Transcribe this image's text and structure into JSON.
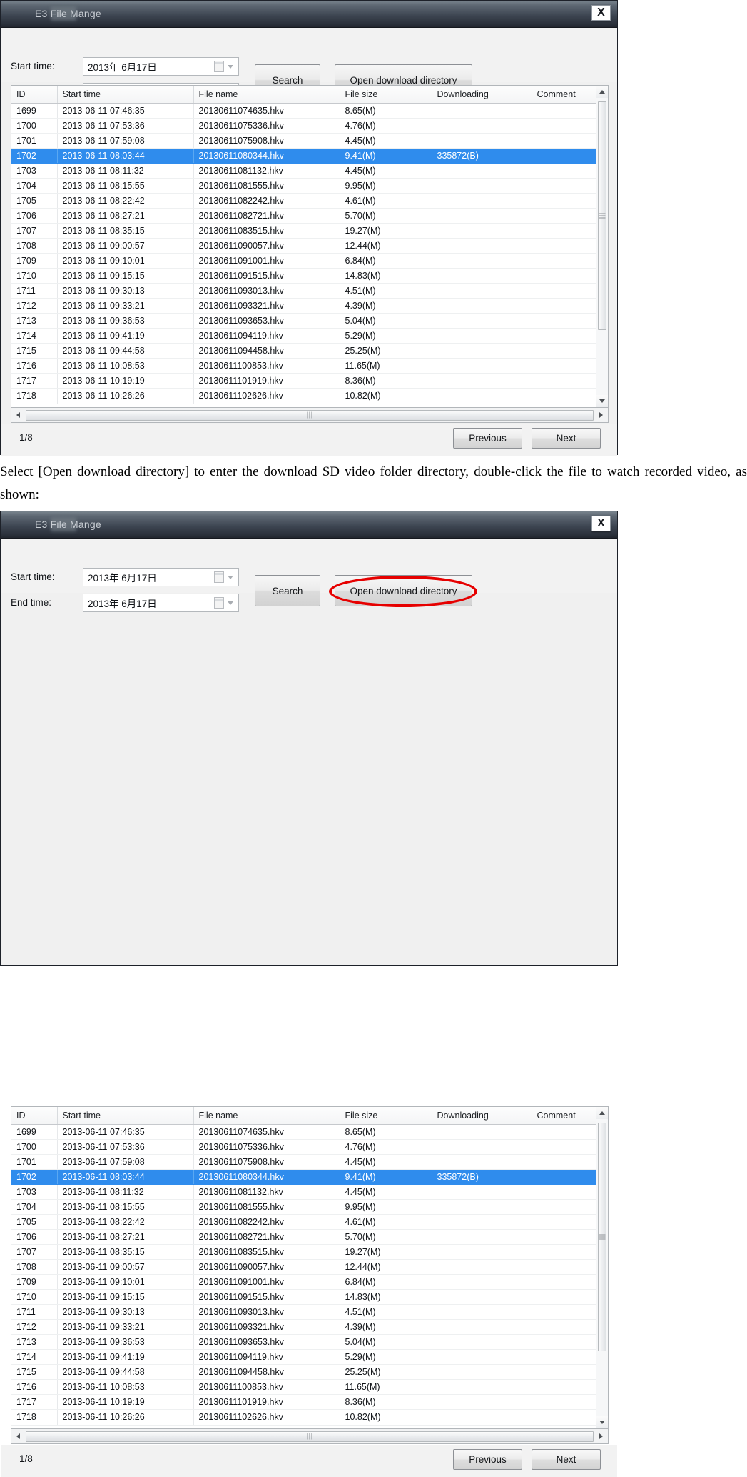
{
  "window": {
    "title": "E3       File Mange",
    "title_prefix": "E3",
    "close_label": "X"
  },
  "toolbar": {
    "start_time_label": "Start time:",
    "end_time_label": "End time:",
    "start_time_value": "2013年 6月17日",
    "end_time_value": "2013年 6月17日",
    "date_placeholder": "2013年 6月17日",
    "search_label": "Search",
    "open_download_label": "Open download directory"
  },
  "table": {
    "columns": [
      "ID",
      "Start time",
      "File name",
      "File size",
      "Downloading",
      "Comment"
    ],
    "rows": [
      {
        "id": "1699",
        "start": "2013-06-11 07:46:35",
        "file": "20130611074635.hkv",
        "size": "8.65(M)",
        "down": "",
        "comment": ""
      },
      {
        "id": "1700",
        "start": "2013-06-11 07:53:36",
        "file": "20130611075336.hkv",
        "size": "4.76(M)",
        "down": "",
        "comment": ""
      },
      {
        "id": "1701",
        "start": "2013-06-11 07:59:08",
        "file": "20130611075908.hkv",
        "size": "4.45(M)",
        "down": "",
        "comment": ""
      },
      {
        "id": "1702",
        "start": "2013-06-11 08:03:44",
        "file": "20130611080344.hkv",
        "size": "9.41(M)",
        "down": "335872(B)",
        "comment": "",
        "selected": true
      },
      {
        "id": "1703",
        "start": "2013-06-11 08:11:32",
        "file": "20130611081132.hkv",
        "size": "4.45(M)",
        "down": "",
        "comment": ""
      },
      {
        "id": "1704",
        "start": "2013-06-11 08:15:55",
        "file": "20130611081555.hkv",
        "size": "9.95(M)",
        "down": "",
        "comment": ""
      },
      {
        "id": "1705",
        "start": "2013-06-11 08:22:42",
        "file": "20130611082242.hkv",
        "size": "4.61(M)",
        "down": "",
        "comment": ""
      },
      {
        "id": "1706",
        "start": "2013-06-11 08:27:21",
        "file": "20130611082721.hkv",
        "size": "5.70(M)",
        "down": "",
        "comment": ""
      },
      {
        "id": "1707",
        "start": "2013-06-11 08:35:15",
        "file": "20130611083515.hkv",
        "size": "19.27(M)",
        "down": "",
        "comment": ""
      },
      {
        "id": "1708",
        "start": "2013-06-11 09:00:57",
        "file": "20130611090057.hkv",
        "size": "12.44(M)",
        "down": "",
        "comment": ""
      },
      {
        "id": "1709",
        "start": "2013-06-11 09:10:01",
        "file": "20130611091001.hkv",
        "size": "6.84(M)",
        "down": "",
        "comment": ""
      },
      {
        "id": "1710",
        "start": "2013-06-11 09:15:15",
        "file": "20130611091515.hkv",
        "size": "14.83(M)",
        "down": "",
        "comment": ""
      },
      {
        "id": "1711",
        "start": "2013-06-11 09:30:13",
        "file": "20130611093013.hkv",
        "size": "4.51(M)",
        "down": "",
        "comment": ""
      },
      {
        "id": "1712",
        "start": "2013-06-11 09:33:21",
        "file": "20130611093321.hkv",
        "size": "4.39(M)",
        "down": "",
        "comment": ""
      },
      {
        "id": "1713",
        "start": "2013-06-11 09:36:53",
        "file": "20130611093653.hkv",
        "size": "5.04(M)",
        "down": "",
        "comment": ""
      },
      {
        "id": "1714",
        "start": "2013-06-11 09:41:19",
        "file": "20130611094119.hkv",
        "size": "5.29(M)",
        "down": "",
        "comment": ""
      },
      {
        "id": "1715",
        "start": "2013-06-11 09:44:58",
        "file": "20130611094458.hkv",
        "size": "25.25(M)",
        "down": "",
        "comment": ""
      },
      {
        "id": "1716",
        "start": "2013-06-11 10:08:53",
        "file": "20130611100853.hkv",
        "size": "11.65(M)",
        "down": "",
        "comment": ""
      },
      {
        "id": "1717",
        "start": "2013-06-11 10:19:19",
        "file": "20130611101919.hkv",
        "size": "8.36(M)",
        "down": "",
        "comment": ""
      },
      {
        "id": "1718",
        "start": "2013-06-11 10:26:26",
        "file": "20130611102626.hkv",
        "size": "10.82(M)",
        "down": "",
        "comment": "",
        "clipped": true
      }
    ]
  },
  "footer": {
    "page_indicator": "1/8",
    "previous_label": "Previous",
    "next_label": "Next"
  },
  "caption": {
    "text": "Select [Open download directory] to enter the download SD video folder directory, double-click the file to watch recorded video, as shown:"
  },
  "colors": {
    "selection_blue": "#2f8ced",
    "annotation_red": "#e60000",
    "titlebar_dark": "#22262f",
    "window_bg": "#f2f2f2"
  },
  "annotation": {
    "highlight_target": "open-download-directory-button",
    "shape": "ellipse"
  }
}
